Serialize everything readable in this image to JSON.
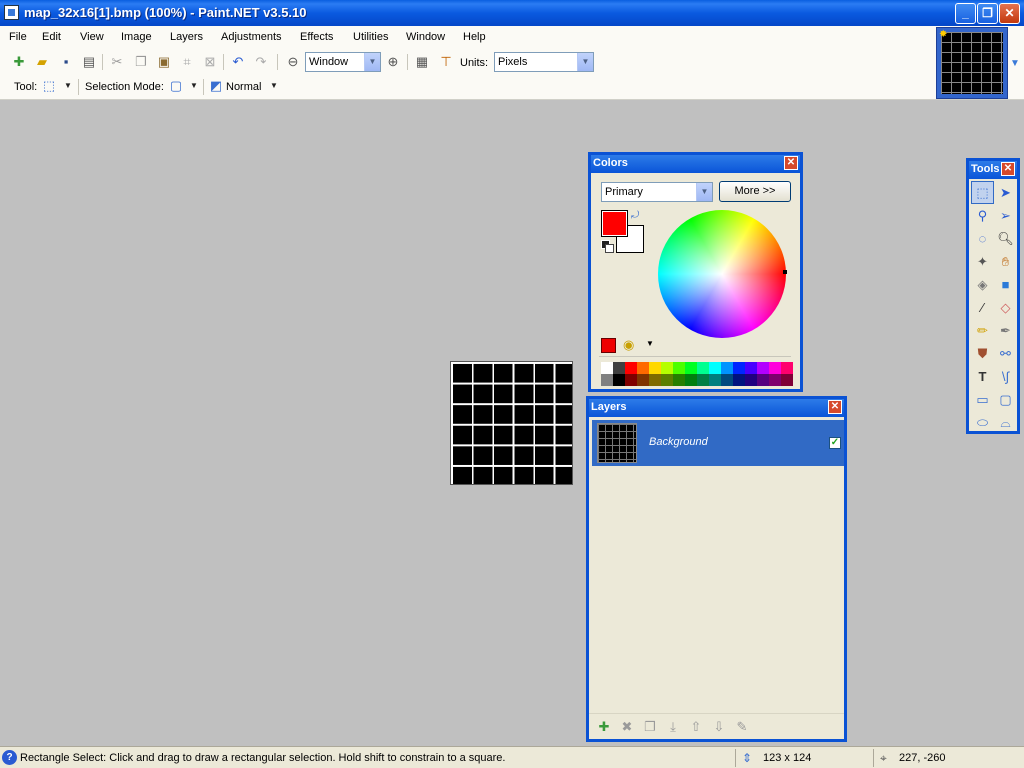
{
  "window": {
    "title": "map_32x16[1].bmp (100%) - Paint.NET v3.5.10",
    "minimize": "_",
    "restore": "❐",
    "close": "✕"
  },
  "menu": [
    "File",
    "Edit",
    "View",
    "Image",
    "Layers",
    "Adjustments",
    "Effects",
    "Utilities",
    "Window",
    "Help"
  ],
  "toolbar": {
    "zoom_value": "Window",
    "units_label": "Units:",
    "units_value": "Pixels"
  },
  "tool_options": {
    "tool_label": "Tool:",
    "selection_mode_label": "Selection Mode:",
    "blend_value": "Normal"
  },
  "colors_window": {
    "title": "Colors",
    "select_value": "Primary",
    "more_button": "More >>",
    "primary_color": "#ff0000",
    "secondary_color": "#ffffff",
    "palette": [
      "#ffffff",
      "#404040",
      "#ff0000",
      "#ff6a00",
      "#ffd800",
      "#b6ff00",
      "#4cff00",
      "#00ff21",
      "#00ff90",
      "#00ffff",
      "#0094ff",
      "#0026ff",
      "#4800ff",
      "#b200ff",
      "#ff00dc",
      "#ff006e",
      "#808080",
      "#000000",
      "#7f0000",
      "#7f3300",
      "#7f6a00",
      "#5b7f00",
      "#267f00",
      "#007f0e",
      "#007f46",
      "#007f7f",
      "#004a7f",
      "#00137f",
      "#21007f",
      "#57007f",
      "#7f006e",
      "#7f0037"
    ]
  },
  "layers_window": {
    "title": "Layers",
    "layer_name": "Background"
  },
  "tools_window": {
    "title": "Tools"
  },
  "statusbar": {
    "help_text": "Rectangle Select: Click and drag to draw a rectangular selection. Hold shift to constrain to a square.",
    "image_size": "123 x 124",
    "cursor_position": "227, -260"
  }
}
